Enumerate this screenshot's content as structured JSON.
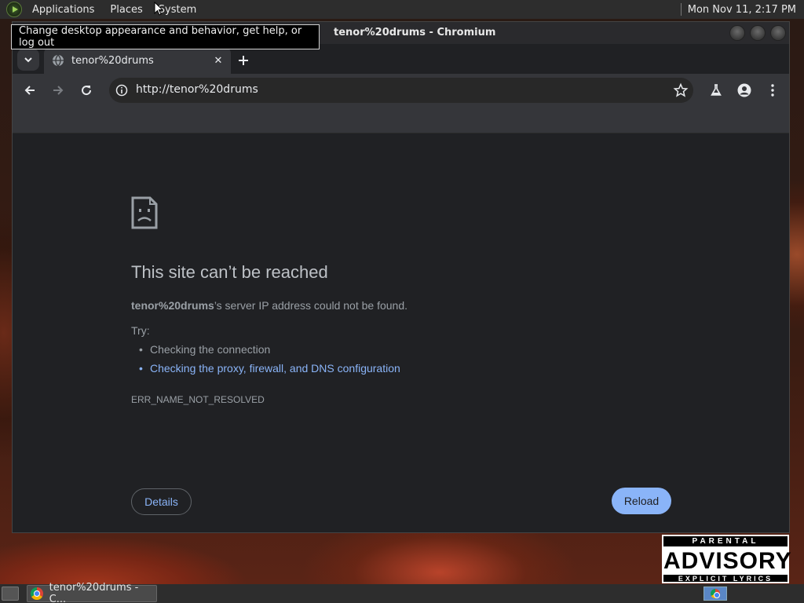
{
  "desktop": {
    "advisory": {
      "top": "PARENTAL",
      "mid": "ADVISORY",
      "bottom": "EXPLICIT LYRICS"
    }
  },
  "top_panel": {
    "menus": [
      "Applications",
      "Places",
      "System"
    ],
    "clock": "Mon Nov 11,  2:17 PM"
  },
  "tooltip": {
    "text": "Change desktop appearance and behavior, get help, or log out"
  },
  "window": {
    "title": "tenor%20drums - Chromium",
    "tab_title": "tenor%20drums",
    "url": "http://tenor%20drums"
  },
  "error_page": {
    "heading": "This site can’t be reached",
    "host": "tenor%20drums",
    "desc_suffix": "’s server IP address could not be found.",
    "try_label": "Try:",
    "suggestions": [
      "Checking the connection",
      "Checking the proxy, firewall, and DNS configuration"
    ],
    "error_code": "ERR_NAME_NOT_RESOLVED",
    "details_label": "Details",
    "reload_label": "Reload",
    "colors": {
      "accent": "#8ab4f8",
      "background": "#202124",
      "text": "#9aa0a6"
    }
  },
  "taskbar": {
    "task_label": "tenor%20drums - C..."
  }
}
